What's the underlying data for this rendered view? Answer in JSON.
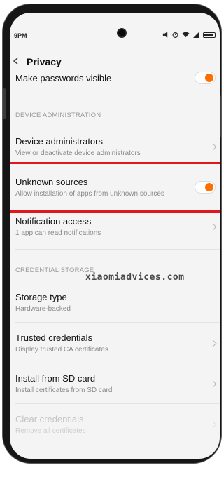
{
  "statusbar": {
    "time": "9PM"
  },
  "header": {
    "title": "Privacy"
  },
  "rows": {
    "make_passwords_visible": {
      "label": "Make passwords visible"
    },
    "device_admins": {
      "label": "Device administrators",
      "sub": "View or deactivate device administrators"
    },
    "unknown_sources": {
      "label": "Unknown sources",
      "sub": "Allow installation of apps from unknown sources"
    },
    "notification_access": {
      "label": "Notification access",
      "sub": "1 app can read notifications"
    },
    "storage_type": {
      "label": "Storage type",
      "sub": "Hardware-backed"
    },
    "trusted_credentials": {
      "label": "Trusted credentials",
      "sub": "Display trusted CA certificates"
    },
    "install_sd": {
      "label": "Install from SD card",
      "sub": "Install certificates from SD card"
    },
    "clear_credentials": {
      "label": "Clear credentials",
      "sub": "Remove all certificates"
    }
  },
  "sections": {
    "device_administration": "DEVICE ADMINISTRATION",
    "credential_storage": "CREDENTIAL STORAGE"
  },
  "watermark": "xiaomiadvices.com",
  "colors": {
    "accent": "#ff6f00",
    "highlight": "#e2161d"
  },
  "toggles": {
    "make_passwords_visible": true,
    "unknown_sources": true
  }
}
